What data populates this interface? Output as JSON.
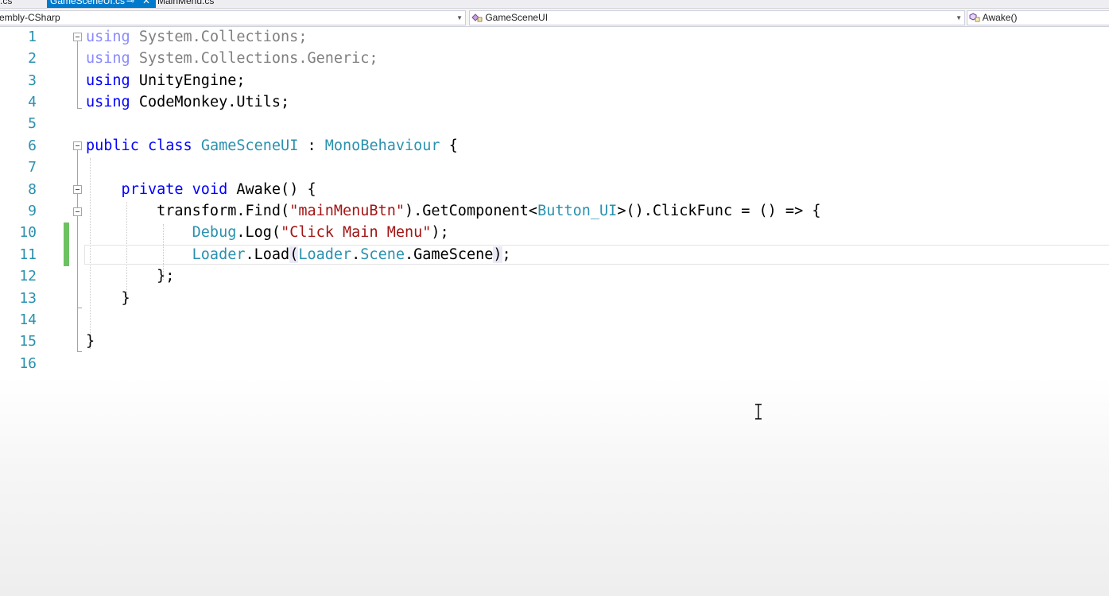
{
  "tabs": [
    {
      "label": ".cs",
      "active": false
    },
    {
      "label": "GameSceneUI.cs",
      "active": true,
      "pin": "⊸",
      "close": "✕"
    },
    {
      "label": "MainMenu.cs",
      "active": false
    }
  ],
  "navbar": {
    "project": "embly-CSharp",
    "type": "GameSceneUI",
    "member": "Awake()"
  },
  "line_numbers": [
    "1",
    "2",
    "3",
    "4",
    "5",
    "6",
    "7",
    "8",
    "9",
    "10",
    "11",
    "12",
    "13",
    "14",
    "15",
    "16"
  ],
  "code": {
    "l1": {
      "kw": "using",
      "rest": " System.Collections;"
    },
    "l2": {
      "kw": "using",
      "rest": " System.Collections.Generic;"
    },
    "l3": {
      "kw": "using",
      "rest": " UnityEngine;"
    },
    "l4": {
      "kw": "using",
      "rest": " CodeMonkey.Utils;"
    },
    "l6": {
      "a": "public",
      "b": " ",
      "c": "class",
      "d": " ",
      "e": "GameSceneUI",
      "f": " : ",
      "g": "MonoBehaviour",
      "h": " {"
    },
    "l8": {
      "a": "    private",
      "b": " ",
      "c": "void",
      "d": " Awake() {"
    },
    "l9": {
      "a": "        transform.Find(",
      "b": "\"mainMenuBtn\"",
      "c": ").GetComponent<",
      "d": "Button_UI",
      "e": ">().ClickFunc = () => {"
    },
    "l10": {
      "a": "            ",
      "b": "Debug",
      "c": ".Log(",
      "d": "\"Click Main Menu\"",
      "e": ");"
    },
    "l11": {
      "a": "            ",
      "b": "Loader",
      "c": ".Load",
      "d": "(",
      "e": "Loader",
      "f": ".",
      "g": "Scene",
      "h": ".GameScene",
      "i": ")",
      "j": ";"
    },
    "l12": "        };",
    "l13": "    }",
    "l15": "}"
  },
  "colors": {
    "keyword": "#0000ff",
    "type": "#2b91af",
    "string": "#a31515",
    "line_number": "#2b91af",
    "changed_margin": "#6cc261",
    "active_tab": "#007acc"
  }
}
